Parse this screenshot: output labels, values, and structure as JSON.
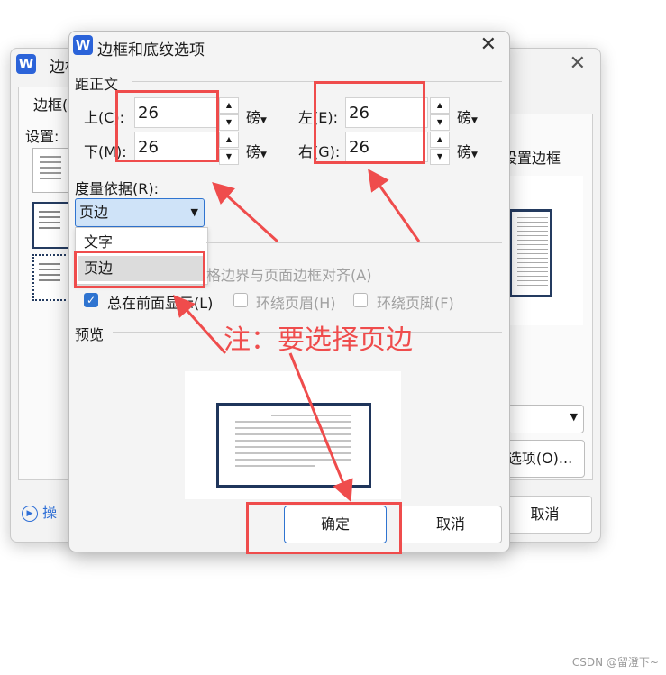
{
  "back_dialog": {
    "app_icon": "W",
    "title": "边框",
    "tab_label": "边框(",
    "settings_label": "设置:",
    "set_border_label": "设置边框",
    "options_button": "选项(O)...",
    "operation_link": "操",
    "cancel_button": "取消"
  },
  "dialog": {
    "app_icon": "W",
    "title": "边框和底纹选项",
    "close_glyph": "✕",
    "margin_section": "距正文",
    "top_label": "上(C):",
    "top_value": "26",
    "bottom_label": "下(M):",
    "bottom_value": "26",
    "left_label": "左(E):",
    "left_value": "26",
    "right_label": "右(G):",
    "right_value": "26",
    "unit": "磅",
    "measure_label": "度量依据(R):",
    "measure_value": "页边",
    "measure_options": [
      "文字",
      "页边"
    ],
    "align_option": "格边界与页面边框对齐(A)",
    "always_front": "总在前面显示(L)",
    "wrap_header": "环绕页眉(H)",
    "wrap_footer": "环绕页脚(F)",
    "preview_label": "预览",
    "ok_button": "确定",
    "cancel_button": "取消"
  },
  "annotation": {
    "note": "注：要选择页边",
    "color": "#ef4c4c"
  },
  "watermark": "CSDN @留澄下~"
}
